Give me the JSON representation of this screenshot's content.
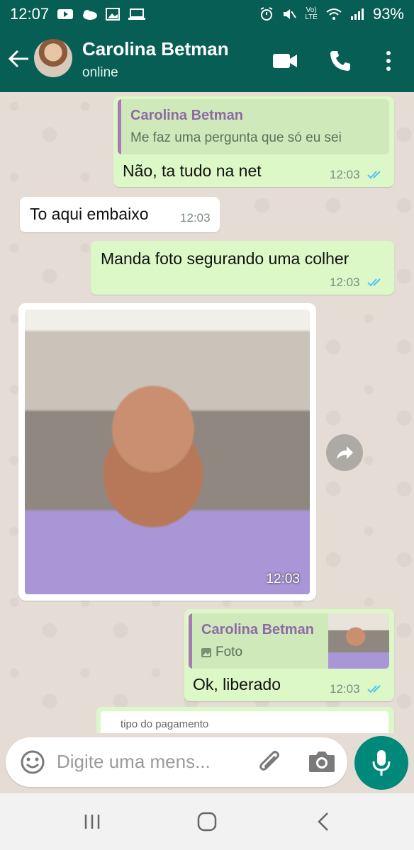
{
  "status_bar": {
    "time": "12:07",
    "battery": "93%",
    "lte_label": "LTE"
  },
  "header": {
    "contact_name": "Carolina Betman",
    "contact_status": "online"
  },
  "messages": [
    {
      "direction": "outgoing",
      "quote_name": "Carolina Betman",
      "quote_text": "Me faz uma pergunta que só eu sei",
      "text": "Não, ta tudo na net",
      "time": "12:03",
      "read": true
    },
    {
      "direction": "incoming",
      "text": "To aqui embaixo",
      "time": "12:03"
    },
    {
      "direction": "outgoing",
      "text": "Manda foto segurando uma colher",
      "time": "12:03",
      "read": true
    },
    {
      "direction": "incoming",
      "type": "photo",
      "time": "12:03"
    },
    {
      "direction": "outgoing",
      "quote_name": "Carolina Betman",
      "quote_text": "Foto",
      "text": "Ok, liberado",
      "time": "12:03",
      "read": true
    },
    {
      "direction": "outgoing",
      "partial_text": "tipo do pagamento"
    }
  ],
  "input": {
    "placeholder": "Digite uma mens..."
  },
  "icons": {
    "back": "arrow-left-icon",
    "video": "video-camera-icon",
    "call": "phone-icon",
    "menu": "more-vertical-icon",
    "emoji": "emoji-icon",
    "attach": "paperclip-icon",
    "camera": "camera-icon",
    "mic": "microphone-icon",
    "forward": "forward-icon"
  },
  "colors": {
    "header": "#075e54",
    "outgoing_bubble": "#dcf8c6",
    "incoming_bubble": "#ffffff",
    "read_ticks": "#4fc3f7",
    "mic_button": "#00897b"
  }
}
